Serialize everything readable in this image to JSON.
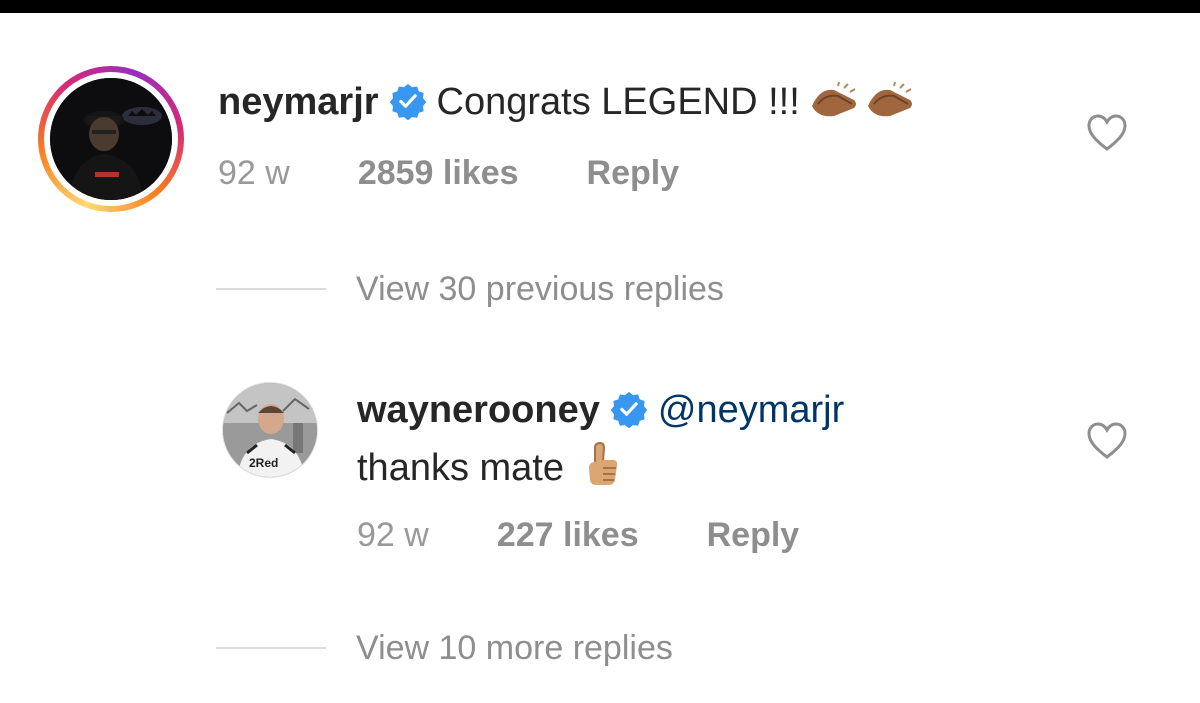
{
  "comment": {
    "username": "neymarjr",
    "text": "Congrats LEGEND !!!",
    "emoji": "clapping-hands-medium-dark",
    "time": "92 w",
    "likes": "2859 likes",
    "reply": "Reply"
  },
  "view_previous": "View 30 previous replies",
  "reply_comment": {
    "username": "waynerooney",
    "mention": "@neymarjr",
    "text": "thanks mate",
    "emoji": "thumbs-up-medium-light",
    "jersey_logo": "2Red",
    "time": "92 w",
    "likes": "227 likes",
    "reply": "Reply"
  },
  "view_more": "View 10 more replies",
  "colors": {
    "verified": "#3897f0",
    "mention": "#003569",
    "secondary_text": "#8e8e8e",
    "divider": "#dbdbdb"
  }
}
